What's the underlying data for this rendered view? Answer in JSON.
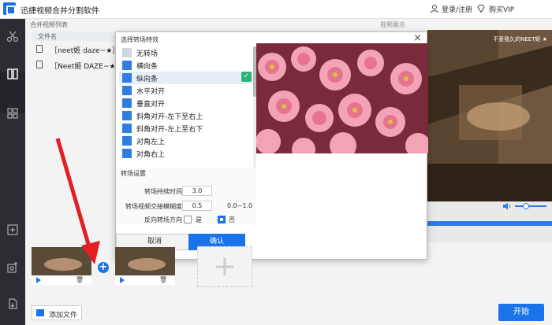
{
  "app": {
    "title": "迅捷视频合并分割软件",
    "login_label": "登录/注册",
    "vip_label": "购买VIP"
  },
  "sidebar": {
    "items": [
      {
        "icon": "scissors-icon"
      },
      {
        "icon": "merge-icon"
      },
      {
        "icon": "grid-icon"
      },
      {
        "icon": "add-icon"
      },
      {
        "icon": "add-media-icon"
      },
      {
        "icon": "export-icon"
      }
    ]
  },
  "file_list": {
    "section_title": "合并视频列表",
    "column_name": "文件名",
    "files": [
      "［neet姬 daze~★］轻",
      "［Neet姬 DAZE~★］轻"
    ]
  },
  "video": {
    "section_title": "视频展示",
    "caption": "不爱我久的NEET姬 ★",
    "volume_percent": 40
  },
  "dialog": {
    "title": "选择转场特效",
    "effects": [
      {
        "label": "无转场",
        "selected": false,
        "plain": true
      },
      {
        "label": "横向条",
        "selected": false,
        "plain": false
      },
      {
        "label": "纵向条",
        "selected": true,
        "plain": false
      },
      {
        "label": "水平对开",
        "selected": false,
        "plain": false
      },
      {
        "label": "垂直对开",
        "selected": false,
        "plain": false
      },
      {
        "label": "斜角对开-左下至右上",
        "selected": false,
        "plain": false
      },
      {
        "label": "斜角对开-左上至右下",
        "selected": false,
        "plain": false
      },
      {
        "label": "对角左上",
        "selected": false,
        "plain": false
      },
      {
        "label": "对角右上",
        "selected": false,
        "plain": false
      }
    ],
    "settings_title": "转场设置",
    "duration_label": "转场持续时间",
    "duration_value": "3.0",
    "blur_label": "转场视频交接模糊度",
    "blur_value": "0.5",
    "blur_range": "0.0~1.0",
    "reverse_label": "反向转场方向",
    "yes_label": "是",
    "no_label": "否",
    "cancel_label": "取消",
    "ok_label": "确认"
  },
  "bottom": {
    "add_file_label": "添加文件",
    "start_label": "开始"
  },
  "colors": {
    "accent": "#1a73e8",
    "sidebar_bg": "#2b2d33",
    "check_green": "#2db37a",
    "arrow_red": "#e31e24"
  }
}
